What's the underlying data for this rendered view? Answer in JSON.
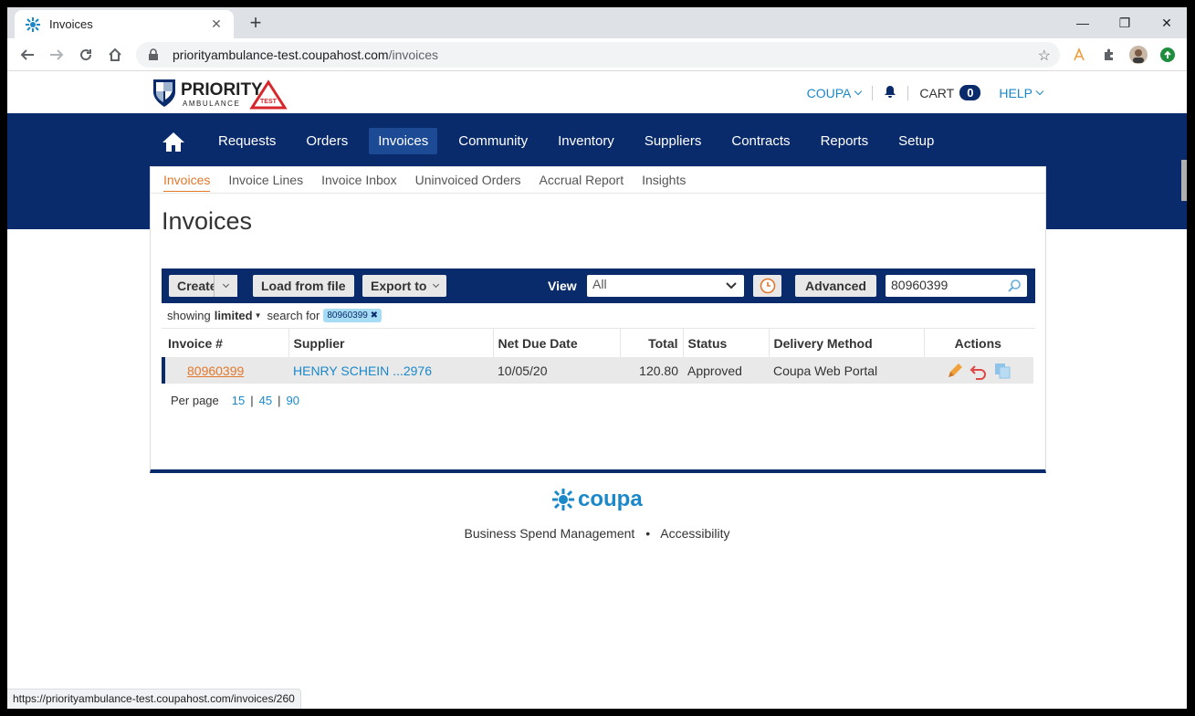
{
  "browser": {
    "tab_title": "Invoices",
    "url_host": "priorityambulance-test.coupahost.com",
    "url_path": "/invoices",
    "status_url": "https://priorityambulance-test.coupahost.com/invoices/260"
  },
  "header": {
    "logo_text": "PRIORITY",
    "logo_sub": "AMBULANCE",
    "logo_badge": "TEST",
    "coupa_menu": "COUPA",
    "cart_label": "CART",
    "cart_count": "0",
    "help_menu": "HELP"
  },
  "main_nav": {
    "items": [
      {
        "label": "Requests"
      },
      {
        "label": "Orders"
      },
      {
        "label": "Invoices"
      },
      {
        "label": "Community"
      },
      {
        "label": "Inventory"
      },
      {
        "label": "Suppliers"
      },
      {
        "label": "Contracts"
      },
      {
        "label": "Reports"
      },
      {
        "label": "Setup"
      }
    ],
    "active": "Invoices"
  },
  "sub_nav": {
    "items": [
      {
        "label": "Invoices"
      },
      {
        "label": "Invoice Lines"
      },
      {
        "label": "Invoice Inbox"
      },
      {
        "label": "Uninvoiced Orders"
      },
      {
        "label": "Accrual Report"
      },
      {
        "label": "Insights"
      }
    ],
    "active": "Invoices"
  },
  "page_title": "Invoices",
  "toolbar": {
    "create_label": "Create",
    "load_label": "Load from file",
    "export_label": "Export to",
    "view_label": "View",
    "view_value": "All",
    "advanced_label": "Advanced",
    "search_value": "80960399"
  },
  "filter": {
    "showing": "showing",
    "limited": "limited",
    "search_for": "search for",
    "chip": "80960399"
  },
  "table": {
    "headers": [
      "Invoice #",
      "Supplier",
      "Net Due Date",
      "Total",
      "Status",
      "Delivery Method",
      "Actions"
    ],
    "rows": [
      {
        "invoice": "80960399",
        "supplier": "HENRY SCHEIN ...2976",
        "net_due": "10/05/20",
        "total": "120.80",
        "status": "Approved",
        "delivery": "Coupa Web Portal"
      }
    ]
  },
  "pagination": {
    "label": "Per page",
    "options": [
      "15",
      "45",
      "90"
    ]
  },
  "footer": {
    "brand": "coupa",
    "link1": "Business Spend Management",
    "separator": "•",
    "link2": "Accessibility"
  },
  "colors": {
    "navy": "#0a2b6b",
    "accent_orange": "#e2782c",
    "link_blue": "#1a88c9"
  }
}
